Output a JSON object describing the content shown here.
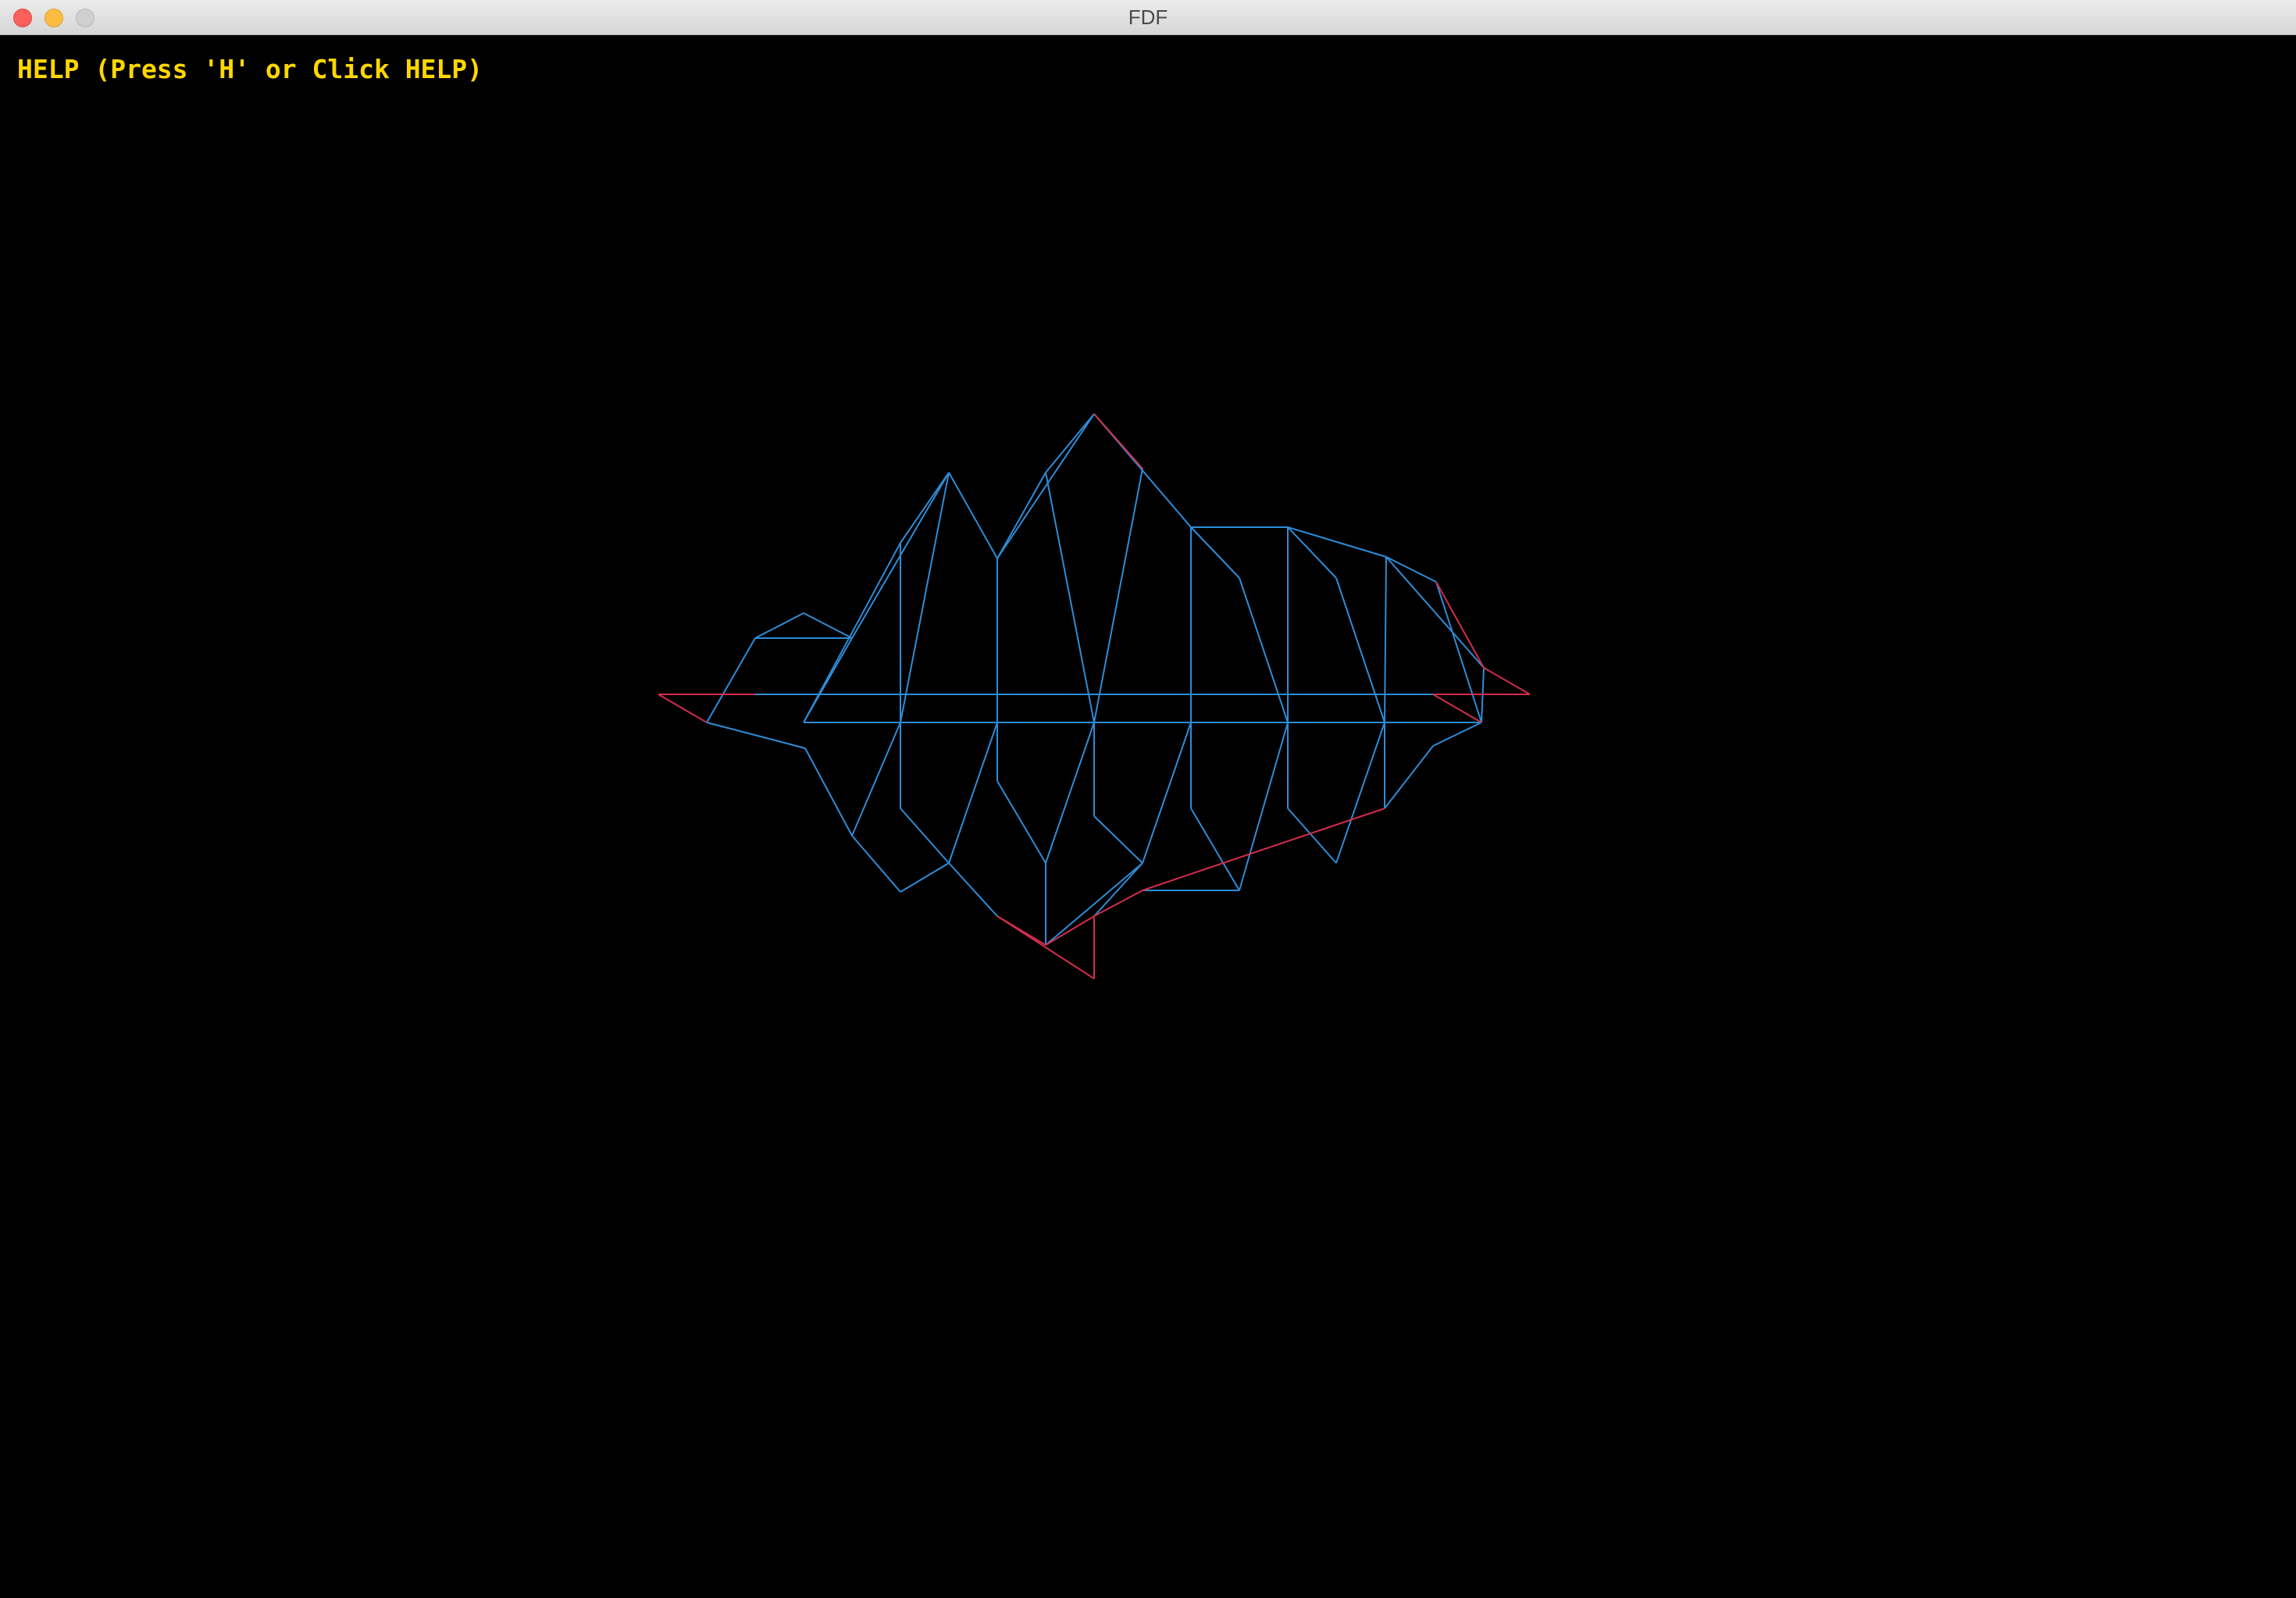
{
  "window": {
    "title": "FDF",
    "controls": [
      "close",
      "minimize",
      "zoom"
    ]
  },
  "overlay": {
    "help_text": "HELP (Press 'H' or Click HELP)",
    "help_color": "#ffd700"
  },
  "colors": {
    "background": "#000000",
    "low_edge": "#d22d4b",
    "high_edge": "#2d8cd7"
  }
}
